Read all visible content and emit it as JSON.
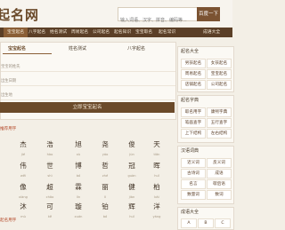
{
  "header": {
    "logo": "起名网",
    "search_placeholder": "输入词语、汉字、拼音、编码等...",
    "search_button": "百度一下"
  },
  "nav": [
    "宝宝起名",
    "八字起名",
    "姓名测试",
    "周易起名",
    "公司起名",
    "起名知识",
    "宝宝取名",
    "起名常识",
    "成语大全"
  ],
  "form": {
    "tabs": [
      "宝宝起名",
      "姓名测试",
      "八字起名"
    ],
    "fields": [
      "宝宝的姓氏",
      "出生日期",
      "出生地"
    ],
    "submit": "立即宝宝起名"
  },
  "recommend_title": "推荐用字",
  "chars": [
    [
      "杰",
      "浩",
      "旭",
      "尧",
      "俊",
      "天"
    ],
    [
      "伟",
      "世",
      "博",
      "哲",
      "冠",
      "晖"
    ],
    [
      "像",
      "超",
      "霖",
      "丽",
      "健",
      "柏"
    ],
    [
      "沐",
      "可",
      "璇",
      "铂",
      "辉",
      "洋"
    ]
  ],
  "chars_sub": [
    [
      "jié",
      "hào",
      "xù",
      "yáo",
      "jùn",
      "tiān"
    ],
    [
      "wěi",
      "shì",
      "bó",
      "zhé",
      "guàn",
      "huī"
    ],
    [
      "xiàng",
      "chāo",
      "lín",
      "lì",
      "jiàn",
      "bǎi"
    ],
    [
      "mù",
      "kě",
      "xuán",
      "bó",
      "huī",
      "yáng"
    ]
  ],
  "section2_title": "起名用字",
  "sidebar": {
    "box1": {
      "title": "起名大全",
      "links": [
        "男孩起名",
        "女孩起名",
        "周易起名",
        "宝宝起名",
        "店铺起名",
        "公司起名"
      ]
    },
    "box2": {
      "title": "起名字典",
      "links": [
        "取名用字",
        "康熙字典",
        "笔画查字",
        "五行查字",
        "上下结构",
        "左右结构"
      ]
    },
    "box3": {
      "title": "汉语词典",
      "links": [
        "近义词",
        "反义词",
        "古诗词",
        "成语",
        "名言",
        "歇后语",
        "数量词",
        "数词"
      ]
    },
    "box4": {
      "title": "成语大全",
      "links": [
        "A",
        "B",
        "C"
      ]
    }
  }
}
